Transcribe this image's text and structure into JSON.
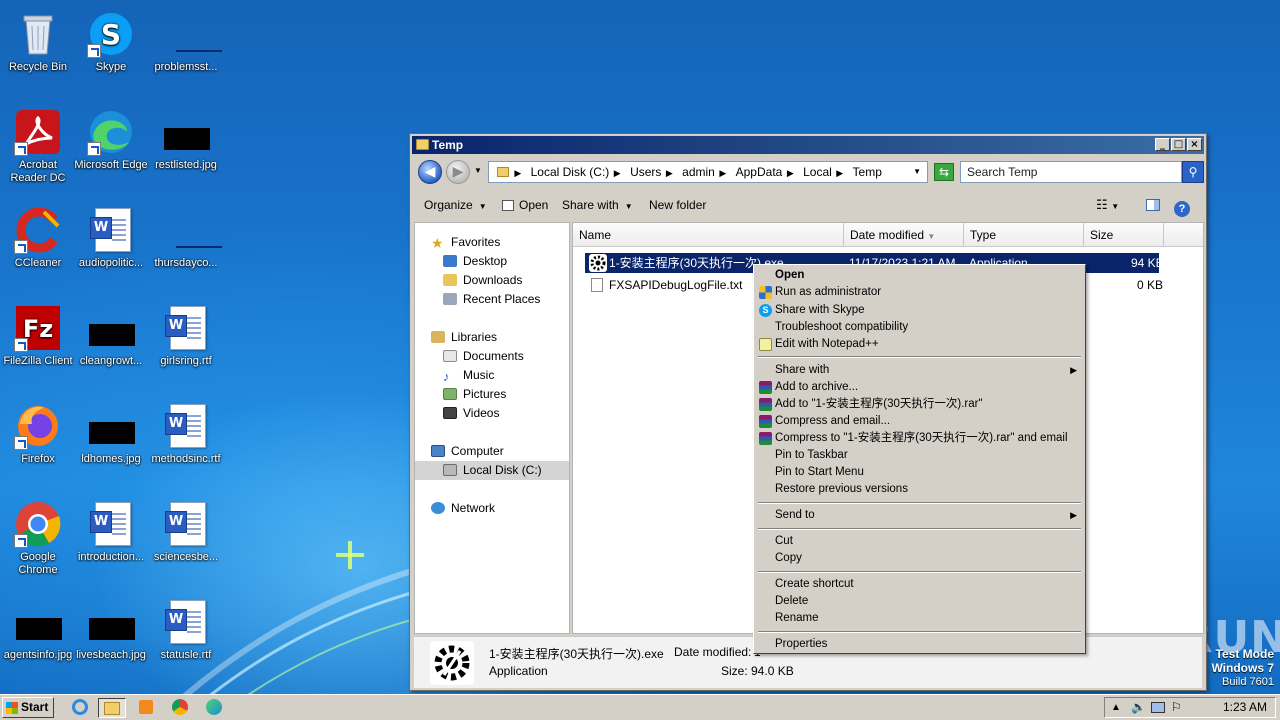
{
  "desktop": {
    "icons": [
      {
        "label": "Recycle Bin",
        "icon": "recycle-bin-icon"
      },
      {
        "label": "Skype",
        "icon": "skype-icon"
      },
      {
        "label": "problemsst...",
        "icon": "image-file-icon"
      },
      {
        "label": "Acrobat Reader DC",
        "icon": "acrobat-icon"
      },
      {
        "label": "Microsoft Edge",
        "icon": "edge-icon"
      },
      {
        "label": "restlisted.jpg",
        "icon": "image-file-icon"
      },
      {
        "label": "CCleaner",
        "icon": "ccleaner-icon"
      },
      {
        "label": "audiopolitic...",
        "icon": "word-doc-icon"
      },
      {
        "label": "thursdayco...",
        "icon": "image-file-icon"
      },
      {
        "label": "FileZilla Client",
        "icon": "filezilla-icon"
      },
      {
        "label": "cleangrowt...",
        "icon": "image-file-icon"
      },
      {
        "label": "girlsring.rtf",
        "icon": "word-doc-icon"
      },
      {
        "label": "Firefox",
        "icon": "firefox-icon"
      },
      {
        "label": "ldhomes.jpg",
        "icon": "image-file-icon"
      },
      {
        "label": "methodsinc.rtf",
        "icon": "word-doc-icon"
      },
      {
        "label": "Google Chrome",
        "icon": "chrome-icon"
      },
      {
        "label": "introduction...",
        "icon": "word-doc-icon"
      },
      {
        "label": "sciencesbe...",
        "icon": "word-doc-icon"
      },
      {
        "label": "agentsinfo.jpg",
        "icon": "image-file-icon"
      },
      {
        "label": "livesbeach.jpg",
        "icon": "image-file-icon"
      },
      {
        "label": "statusle.rtf",
        "icon": "word-doc-icon"
      }
    ]
  },
  "explorer": {
    "title": "Temp",
    "window_buttons": {
      "minimize": "_",
      "maximize": "□",
      "close": "×"
    },
    "breadcrumb": [
      "Local Disk (C:)",
      "Users",
      "admin",
      "AppData",
      "Local",
      "Temp"
    ],
    "search_placeholder": "Search Temp",
    "toolbar": {
      "organize": "Organize",
      "open": "Open",
      "share_with": "Share with",
      "new_folder": "New folder"
    },
    "nav": {
      "favorites": "Favorites",
      "desktop": "Desktop",
      "downloads": "Downloads",
      "recent_places": "Recent Places",
      "libraries": "Libraries",
      "documents": "Documents",
      "music": "Music",
      "pictures": "Pictures",
      "videos": "Videos",
      "computer": "Computer",
      "local_disk": "Local Disk (C:)",
      "network": "Network"
    },
    "columns": {
      "name": "Name",
      "date_modified": "Date modified",
      "type": "Type",
      "size": "Size"
    },
    "files": [
      {
        "name": "1-安装主程序(30天执行一次).exe",
        "date": "11/17/2023 1:21 AM",
        "type": "Application",
        "size": "94 KB"
      },
      {
        "name": "FXSAPIDebugLogFile.txt",
        "date": "",
        "type": "",
        "size": "0 KB"
      }
    ],
    "details": {
      "name": "1-安装主程序(30天执行一次).exe",
      "type": "Application",
      "date_label": "Date modified:",
      "date_value": "1",
      "size": "Size: 94.0 KB"
    }
  },
  "context_menu": {
    "open": "Open",
    "run_as_admin": "Run as administrator",
    "share_skype": "Share with Skype",
    "troubleshoot": "Troubleshoot compatibility",
    "edit_npp": "Edit with Notepad++",
    "share_with": "Share with",
    "add_archive": "Add to archive...",
    "add_rar": "Add to \"1-安装主程序(30天执行一次).rar\"",
    "compress_email": "Compress and email...",
    "compress_rar_email": "Compress to \"1-安装主程序(30天执行一次).rar\" and email",
    "pin_taskbar": "Pin to Taskbar",
    "pin_start": "Pin to Start Menu",
    "restore": "Restore previous versions",
    "send_to": "Send to",
    "cut": "Cut",
    "copy": "Copy",
    "create_shortcut": "Create shortcut",
    "delete": "Delete",
    "rename": "Rename",
    "properties": "Properties"
  },
  "watermark": "ANY▷RUN",
  "test_mode": {
    "line1": "Test Mode",
    "line2": "Windows 7",
    "line3": "Build 7601"
  },
  "taskbar": {
    "start": "Start",
    "clock": "1:23 AM"
  }
}
